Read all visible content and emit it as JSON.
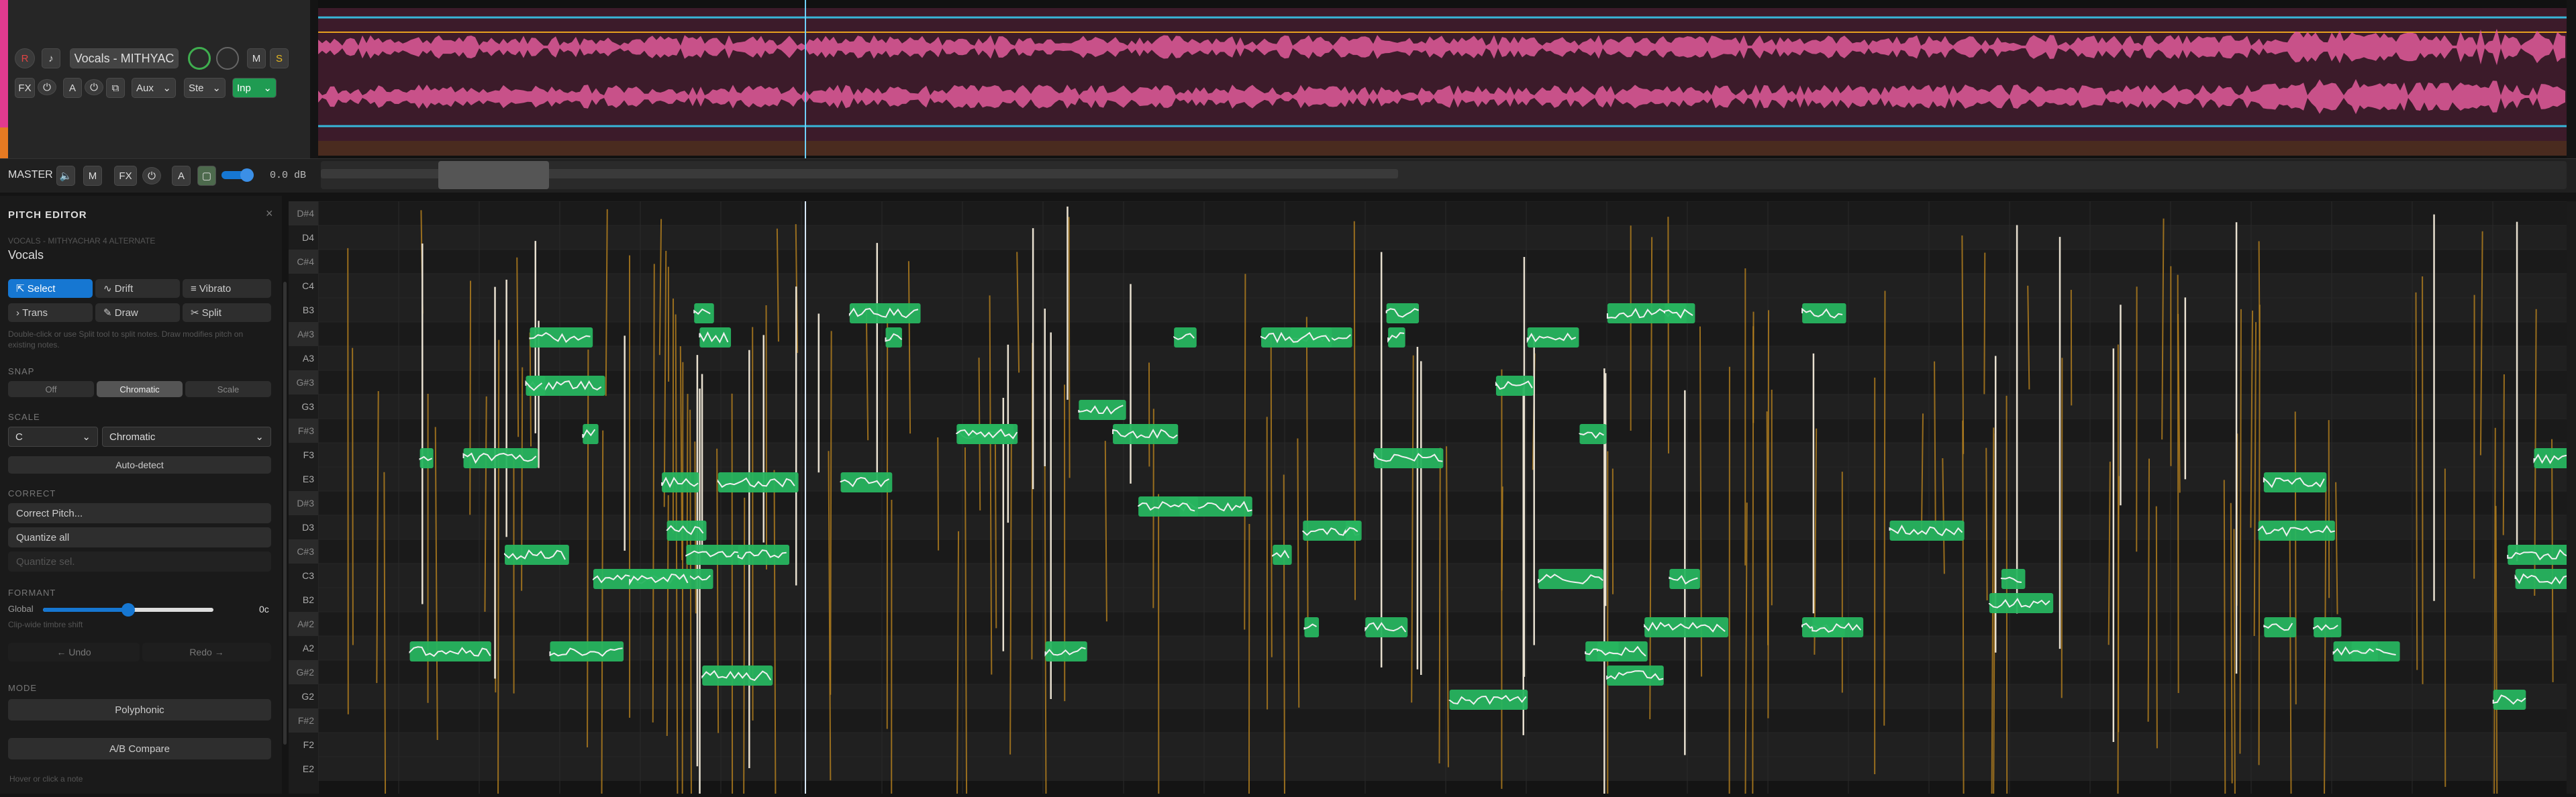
{
  "track": {
    "record_label": "R",
    "name": "Vocals - MITHYAC",
    "mute_label": "M",
    "solo_label": "S",
    "fx_label": "FX",
    "auto_label": "A",
    "aux_select": "Aux",
    "stereo_select": "Ste",
    "input_select": "Inp"
  },
  "master": {
    "label": "MASTER",
    "mute_label": "M",
    "fx_label": "FX",
    "auto_label": "A",
    "volume_readout": "0.0 dB"
  },
  "pitch_editor": {
    "title": "PITCH EDITOR",
    "close_glyph": "×",
    "clip_path": "VOCALS - MITHYACHAR 4 ALTERNATE",
    "track_name": "Vocals",
    "tools": [
      {
        "label": "Select",
        "icon": "select-icon",
        "active": true
      },
      {
        "label": "Drift",
        "icon": "drift-icon",
        "active": false
      },
      {
        "label": "Vibrato",
        "icon": "vibrato-icon",
        "active": false
      },
      {
        "label": "Trans",
        "icon": "trans-icon",
        "active": false
      },
      {
        "label": "Draw",
        "icon": "pencil-icon",
        "active": false
      },
      {
        "label": "Split",
        "icon": "scissors-icon",
        "active": false
      }
    ],
    "hint": "Double-click or use Split tool to split notes. Draw modifies pitch on existing notes.",
    "snap_title": "SNAP",
    "snap_options": [
      "Off",
      "Chromatic",
      "Scale"
    ],
    "snap_selected": "Chromatic",
    "scale_title": "SCALE",
    "scale_key": "C",
    "scale_type": "Chromatic",
    "auto_detect_label": "Auto-detect",
    "correct_title": "CORRECT",
    "correct_pitch_label": "Correct Pitch...",
    "quantize_all_label": "Quantize all",
    "quantize_sel_label": "Quantize sel.",
    "formant_title": "FORMANT",
    "formant_global_label": "Global",
    "formant_value": "0c",
    "formant_level": 0.5,
    "formant_hint": "Clip-wide timbre shift",
    "undo_label": "← Undo",
    "redo_label": "Redo →",
    "mode_title": "MODE",
    "mode_label": "Polyphonic",
    "ab_label": "A/B Compare",
    "status_hint": "Hover or click a note"
  },
  "piano_keys": [
    "D#4",
    "D4",
    "C#4",
    "C4",
    "B3",
    "A#3",
    "A3",
    "G#3",
    "G3",
    "F#3",
    "F3",
    "E3",
    "D#3",
    "D3",
    "C#3",
    "C3",
    "B2",
    "A#2",
    "A2",
    "G#2",
    "G2",
    "F#2",
    "F2",
    "E2"
  ],
  "colors": {
    "accent": "#1677d2",
    "note": "#27b45f",
    "waveform": "#e05a9a",
    "pitch_line": "#b8821e",
    "track_strip": "#e23a8f"
  }
}
